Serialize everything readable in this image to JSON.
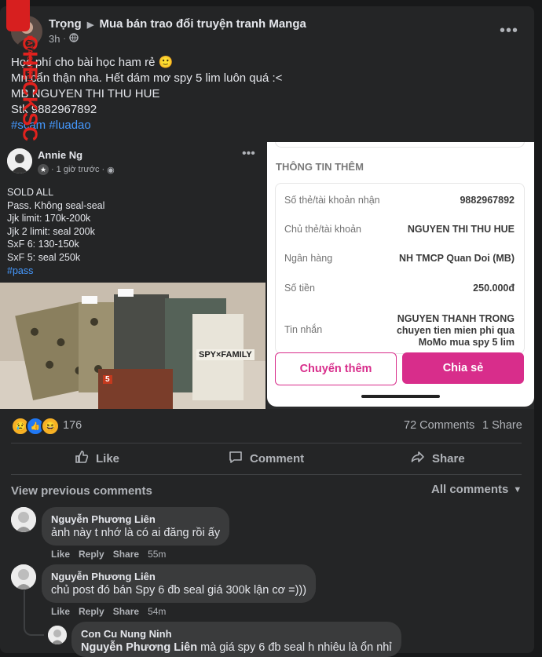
{
  "post": {
    "author": "Trọng",
    "group": "Mua bán trao đổi truyện tranh Manga",
    "time": "3h",
    "lines": [
      "Học phí cho bài học ham rẻ 🙂",
      "Mn cẩn thận nha. Hết dám mơ spy 5 lim luôn quá :<",
      "MB NGUYEN THI THU HUE",
      "Stk 9882967892"
    ],
    "hashtags": "#scam #luadao"
  },
  "inner_post": {
    "author": "Annie Ng",
    "time": "1 giờ trước",
    "lines": [
      "SOLD ALL",
      "Pass. Không seal-seal",
      "Jjk limit: 170k-200k",
      "Jjk 2 limit: seal 200k",
      "SxF 6: 130-150k",
      "SxF 5: seal 250k"
    ],
    "hashtag": "#pass"
  },
  "momo": {
    "section_title": "THÔNG TIN THÊM",
    "rows": [
      {
        "label": "Số thẻ/tài khoản nhận",
        "value": "9882967892"
      },
      {
        "label": "Chủ thẻ/tài khoản",
        "value": "NGUYEN THI THU HUE"
      },
      {
        "label": "Ngân hàng",
        "value": "NH TMCP Quan Doi (MB)"
      },
      {
        "label": "Số tiền",
        "value": "250.000đ"
      },
      {
        "label": "Tin nhắn",
        "value_lines": [
          "NGUYEN THANH TRONG",
          "chuyen tien mien phi qua",
          "MoMo mua spy 5 lim"
        ]
      }
    ],
    "btn_more": "Chuyển thêm",
    "btn_share": "Chia sẻ",
    "accent": "#d82d8b"
  },
  "stats": {
    "reactions": "176",
    "comments": "72 Comments",
    "shares": "1 Share"
  },
  "actions": {
    "like": "Like",
    "comment": "Comment",
    "share": "Share"
  },
  "comments_header": {
    "view_previous": "View previous comments",
    "filter": "All comments"
  },
  "comments": [
    {
      "name": "Nguyễn Phương Liên",
      "text": "ảnh này t nhớ là có ai đăng rồi ấy",
      "like": "Like",
      "reply": "Reply",
      "share": "Share",
      "time": "55m"
    },
    {
      "name": "Nguyễn Phương Liên",
      "text": "chủ post đó bán Spy 6 đb seal giá 300k lận cơ =)))",
      "like": "Like",
      "reply": "Reply",
      "share": "Share",
      "time": "54m"
    },
    {
      "name": "Con Cu Nung Ninh",
      "mention": "Nguyễn Phương Liên",
      "text": " mà giá spy 6 đb seal h nhiêu là ổn nhỉ"
    }
  ],
  "watermark": {
    "text": "CHECKSCAM.INFO",
    "sub": "DATA CENTER"
  },
  "photo_labels": {
    "manga_title": "SPY×FAMILY",
    "volume": "5"
  },
  "icons": {
    "group_arrow": "caret-right-icon",
    "globe": "globe-icon",
    "more": "more-dots-icon"
  }
}
